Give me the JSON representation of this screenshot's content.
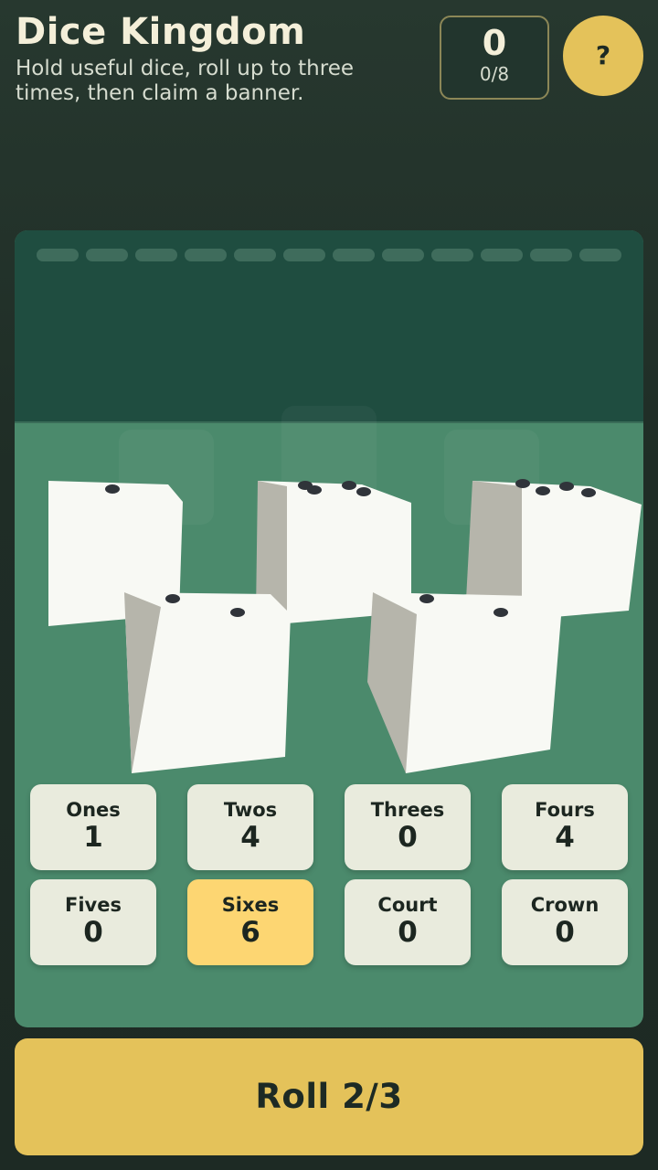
{
  "header": {
    "title": "Dice Kingdom",
    "subtitle": "Hold useful dice, roll up to three times, then claim a banner."
  },
  "score": {
    "value": "0",
    "progress": "0/8",
    "help_label": "?"
  },
  "rounds": {
    "total": 12,
    "completed": 0
  },
  "dice": [
    {
      "name": "die-1",
      "face": 1
    },
    {
      "name": "die-2",
      "face": 4
    },
    {
      "name": "die-3",
      "face": 4
    },
    {
      "name": "die-4",
      "face": 2
    },
    {
      "name": "die-5",
      "face": 2
    }
  ],
  "categories": [
    {
      "label": "Ones",
      "value": "1",
      "highlighted": false
    },
    {
      "label": "Twos",
      "value": "4",
      "highlighted": false
    },
    {
      "label": "Threes",
      "value": "0",
      "highlighted": false
    },
    {
      "label": "Fours",
      "value": "4",
      "highlighted": false
    },
    {
      "label": "Fives",
      "value": "0",
      "highlighted": false
    },
    {
      "label": "Sixes",
      "value": "6",
      "highlighted": true
    },
    {
      "label": "Court",
      "value": "0",
      "highlighted": false
    },
    {
      "label": "Crown",
      "value": "0",
      "highlighted": false
    }
  ],
  "roll_button": {
    "label": "Roll 2/3"
  },
  "colors": {
    "accent": "#e4c25a",
    "highlight": "#fdd672",
    "felt": "#4b8a6c",
    "board_back": "#1f4d40"
  }
}
